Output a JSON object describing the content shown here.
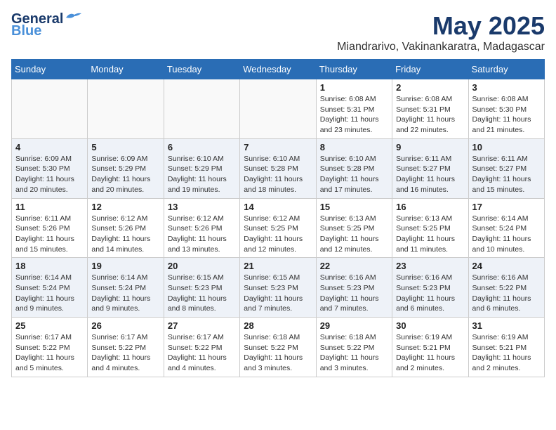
{
  "header": {
    "logo_line1": "General",
    "logo_line2": "Blue",
    "month": "May 2025",
    "location": "Miandrarivo, Vakinankaratra, Madagascar"
  },
  "weekdays": [
    "Sunday",
    "Monday",
    "Tuesday",
    "Wednesday",
    "Thursday",
    "Friday",
    "Saturday"
  ],
  "weeks": [
    [
      {
        "day": "",
        "info": ""
      },
      {
        "day": "",
        "info": ""
      },
      {
        "day": "",
        "info": ""
      },
      {
        "day": "",
        "info": ""
      },
      {
        "day": "1",
        "info": "Sunrise: 6:08 AM\nSunset: 5:31 PM\nDaylight: 11 hours\nand 23 minutes."
      },
      {
        "day": "2",
        "info": "Sunrise: 6:08 AM\nSunset: 5:31 PM\nDaylight: 11 hours\nand 22 minutes."
      },
      {
        "day": "3",
        "info": "Sunrise: 6:08 AM\nSunset: 5:30 PM\nDaylight: 11 hours\nand 21 minutes."
      }
    ],
    [
      {
        "day": "4",
        "info": "Sunrise: 6:09 AM\nSunset: 5:30 PM\nDaylight: 11 hours\nand 20 minutes."
      },
      {
        "day": "5",
        "info": "Sunrise: 6:09 AM\nSunset: 5:29 PM\nDaylight: 11 hours\nand 20 minutes."
      },
      {
        "day": "6",
        "info": "Sunrise: 6:10 AM\nSunset: 5:29 PM\nDaylight: 11 hours\nand 19 minutes."
      },
      {
        "day": "7",
        "info": "Sunrise: 6:10 AM\nSunset: 5:28 PM\nDaylight: 11 hours\nand 18 minutes."
      },
      {
        "day": "8",
        "info": "Sunrise: 6:10 AM\nSunset: 5:28 PM\nDaylight: 11 hours\nand 17 minutes."
      },
      {
        "day": "9",
        "info": "Sunrise: 6:11 AM\nSunset: 5:27 PM\nDaylight: 11 hours\nand 16 minutes."
      },
      {
        "day": "10",
        "info": "Sunrise: 6:11 AM\nSunset: 5:27 PM\nDaylight: 11 hours\nand 15 minutes."
      }
    ],
    [
      {
        "day": "11",
        "info": "Sunrise: 6:11 AM\nSunset: 5:26 PM\nDaylight: 11 hours\nand 15 minutes."
      },
      {
        "day": "12",
        "info": "Sunrise: 6:12 AM\nSunset: 5:26 PM\nDaylight: 11 hours\nand 14 minutes."
      },
      {
        "day": "13",
        "info": "Sunrise: 6:12 AM\nSunset: 5:26 PM\nDaylight: 11 hours\nand 13 minutes."
      },
      {
        "day": "14",
        "info": "Sunrise: 6:12 AM\nSunset: 5:25 PM\nDaylight: 11 hours\nand 12 minutes."
      },
      {
        "day": "15",
        "info": "Sunrise: 6:13 AM\nSunset: 5:25 PM\nDaylight: 11 hours\nand 12 minutes."
      },
      {
        "day": "16",
        "info": "Sunrise: 6:13 AM\nSunset: 5:25 PM\nDaylight: 11 hours\nand 11 minutes."
      },
      {
        "day": "17",
        "info": "Sunrise: 6:14 AM\nSunset: 5:24 PM\nDaylight: 11 hours\nand 10 minutes."
      }
    ],
    [
      {
        "day": "18",
        "info": "Sunrise: 6:14 AM\nSunset: 5:24 PM\nDaylight: 11 hours\nand 9 minutes."
      },
      {
        "day": "19",
        "info": "Sunrise: 6:14 AM\nSunset: 5:24 PM\nDaylight: 11 hours\nand 9 minutes."
      },
      {
        "day": "20",
        "info": "Sunrise: 6:15 AM\nSunset: 5:23 PM\nDaylight: 11 hours\nand 8 minutes."
      },
      {
        "day": "21",
        "info": "Sunrise: 6:15 AM\nSunset: 5:23 PM\nDaylight: 11 hours\nand 7 minutes."
      },
      {
        "day": "22",
        "info": "Sunrise: 6:16 AM\nSunset: 5:23 PM\nDaylight: 11 hours\nand 7 minutes."
      },
      {
        "day": "23",
        "info": "Sunrise: 6:16 AM\nSunset: 5:23 PM\nDaylight: 11 hours\nand 6 minutes."
      },
      {
        "day": "24",
        "info": "Sunrise: 6:16 AM\nSunset: 5:22 PM\nDaylight: 11 hours\nand 6 minutes."
      }
    ],
    [
      {
        "day": "25",
        "info": "Sunrise: 6:17 AM\nSunset: 5:22 PM\nDaylight: 11 hours\nand 5 minutes."
      },
      {
        "day": "26",
        "info": "Sunrise: 6:17 AM\nSunset: 5:22 PM\nDaylight: 11 hours\nand 4 minutes."
      },
      {
        "day": "27",
        "info": "Sunrise: 6:17 AM\nSunset: 5:22 PM\nDaylight: 11 hours\nand 4 minutes."
      },
      {
        "day": "28",
        "info": "Sunrise: 6:18 AM\nSunset: 5:22 PM\nDaylight: 11 hours\nand 3 minutes."
      },
      {
        "day": "29",
        "info": "Sunrise: 6:18 AM\nSunset: 5:22 PM\nDaylight: 11 hours\nand 3 minutes."
      },
      {
        "day": "30",
        "info": "Sunrise: 6:19 AM\nSunset: 5:21 PM\nDaylight: 11 hours\nand 2 minutes."
      },
      {
        "day": "31",
        "info": "Sunrise: 6:19 AM\nSunset: 5:21 PM\nDaylight: 11 hours\nand 2 minutes."
      }
    ]
  ]
}
